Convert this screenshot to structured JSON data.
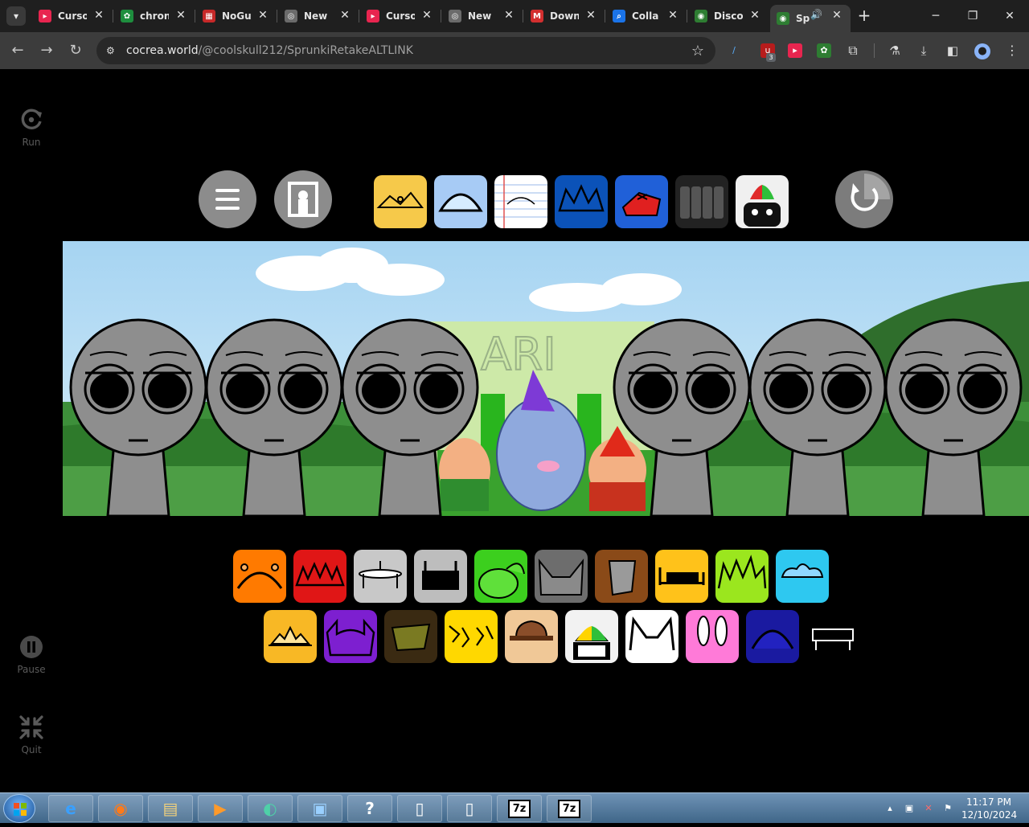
{
  "browser": {
    "tab_search_icon": "chevron-down-icon",
    "tabs": [
      {
        "label": "Curso",
        "favicon_color": "#e8254f",
        "favicon_glyph": "▸"
      },
      {
        "label": "chron",
        "favicon_color": "#1e8e3e",
        "favicon_glyph": "✿"
      },
      {
        "label": "NoGu",
        "favicon_color": "#c62828",
        "favicon_glyph": "▦"
      },
      {
        "label": "New",
        "favicon_color": "#6b6b6b",
        "favicon_glyph": "◎"
      },
      {
        "label": "Curso",
        "favicon_color": "#e8254f",
        "favicon_glyph": "▸"
      },
      {
        "label": "New",
        "favicon_color": "#6b6b6b",
        "favicon_glyph": "◎"
      },
      {
        "label": "Down",
        "favicon_color": "#d32f2f",
        "favicon_glyph": "M"
      },
      {
        "label": "Colla",
        "favicon_color": "#1a73e8",
        "favicon_glyph": "⌕"
      },
      {
        "label": "Disco",
        "favicon_color": "#2e7d32",
        "favicon_glyph": "◉"
      },
      {
        "label": "Sp",
        "favicon_color": "#2e7d32",
        "favicon_glyph": "◉",
        "active": true
      }
    ],
    "tab_close_glyph": "✕",
    "new_tab_glyph": "+",
    "url_host": "cocrea.world",
    "url_path": "/@coolskull212/SprunkiRetakeALTLINK",
    "extension_badge": "3"
  },
  "sidebar": {
    "run_label": "Run",
    "pause_label": "Pause",
    "quit_label": "Quit"
  },
  "top_tiles": [
    {
      "name": "yellow-crown",
      "color": "#f6c94a"
    },
    {
      "name": "blue-dome",
      "color": "#a7cbf5"
    },
    {
      "name": "notebook-paper",
      "color": "#ffffff"
    },
    {
      "name": "dark-blue-crown",
      "color": "#0b52b8"
    },
    {
      "name": "red-house",
      "color": "#2060d8"
    },
    {
      "name": "dark-figures",
      "color": "#222222"
    },
    {
      "name": "propeller-cat",
      "color": "#f0f0f0"
    }
  ],
  "bottom_row1": [
    {
      "name": "orange-headband",
      "color": "#ff7a00"
    },
    {
      "name": "red-spikes",
      "color": "#e01616"
    },
    {
      "name": "grey-saucer",
      "color": "#c8c8c8"
    },
    {
      "name": "grey-visor",
      "color": "#bdbdbd"
    },
    {
      "name": "green-leaf",
      "color": "#3ccf1e"
    },
    {
      "name": "dark-grey-ears",
      "color": "#6d6d6d"
    },
    {
      "name": "brown-bucket",
      "color": "#8a4a18"
    },
    {
      "name": "yellow-bed",
      "color": "#ffc21a"
    },
    {
      "name": "lime-spikes",
      "color": "#9be61e"
    },
    {
      "name": "cyan-cloud",
      "color": "#2ec8f0"
    }
  ],
  "bottom_row2": [
    {
      "name": "orange-sun",
      "color": "#f8b825"
    },
    {
      "name": "purple-horns",
      "color": "#7d1fd0"
    },
    {
      "name": "olive-bowl",
      "color": "#3a2a12"
    },
    {
      "name": "yellow-cracks",
      "color": "#ffd800"
    },
    {
      "name": "tan-hat",
      "color": "#f0c897"
    },
    {
      "name": "propeller-cap",
      "color": "#f2f2f2"
    },
    {
      "name": "white-cat-ears",
      "color": "#ffffff"
    },
    {
      "name": "pink-bunny",
      "color": "#ff7ad8"
    },
    {
      "name": "navy-dome",
      "color": "#1a1aa0"
    },
    {
      "name": "bench-outline",
      "color": "#000000"
    }
  ],
  "stage": {
    "sign_text": "ARI"
  },
  "taskbar": {
    "apps": [
      "IE",
      "Firefox",
      "Explorer",
      "Media",
      "Chrome",
      "Remote",
      "Help",
      "Doc",
      "Doc",
      "7z",
      "7z"
    ],
    "app_7z_label": "7z",
    "clock_time": "11:17 PM",
    "clock_date": "12/10/2024"
  }
}
